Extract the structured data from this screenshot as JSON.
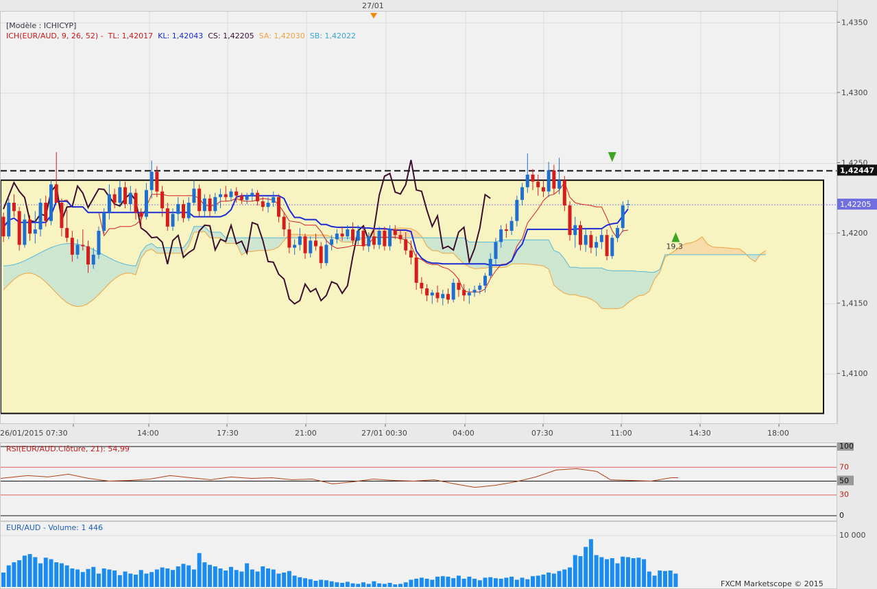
{
  "top_marker": {
    "label": "27/01"
  },
  "legend": {
    "model": "[Modèle : ICHICYP]",
    "ich": "ICH(EUR/AUD, 9, 26, 52) -",
    "tl": "TL: 1,42017",
    "kl": "KL: 1,42043",
    "cs": "CS: 1,42205",
    "sa": "SA: 1,42030",
    "sb": "SB: 1,42022"
  },
  "price_axis": {
    "ticks": [
      "1,4350",
      "1,4300",
      "1,4250",
      "1,4200",
      "1,4150",
      "1,4100"
    ],
    "tick_values": [
      1.435,
      1.43,
      1.425,
      1.42,
      1.415,
      1.41
    ],
    "box_black": "1,42447",
    "box_blue": "1,42205"
  },
  "time_axis": {
    "labels": [
      "26/01/2015 07:30",
      "14:00",
      "17:30",
      "21:00",
      "27/01 00:30",
      "04:00",
      "07:30",
      "11:00",
      "14:30",
      "18:00"
    ]
  },
  "annotations": {
    "pips": "19,3"
  },
  "rsi": {
    "title": "RSI(EUR/AUD.Clôture, 21): 54,99",
    "levels": [
      "100",
      "70",
      "50",
      "30",
      "0"
    ]
  },
  "volume": {
    "title": "EUR/AUD - Volume: 1 446",
    "axis_label": "10 000",
    "copyright": "FXCM Marketscope © 2015"
  },
  "colors": {
    "bull": "#1f6fd1",
    "bear": "#d51d1d",
    "tenkan": "#d62020",
    "kijun": "#1a2bd6",
    "chikou": "#3b0d2e",
    "senkou_a": "#f0a340",
    "senkou_b": "#58b8d6",
    "zone_fill": "#f8f4c2",
    "volume": "#1a8cf0"
  },
  "chart_data": {
    "type": "candlestick",
    "symbol": "EUR/AUD",
    "ylim": [
      1.4065,
      1.4358
    ],
    "resistance": 1.42447,
    "current_price": 1.42205,
    "zone": [
      1.4072,
      1.4238
    ],
    "candles": [
      [
        1.4212,
        1.4215,
        1.4194,
        1.4198
      ],
      [
        1.4198,
        1.4225,
        1.4196,
        1.4222
      ],
      [
        1.4222,
        1.4228,
        1.4212,
        1.4216
      ],
      [
        1.4216,
        1.4219,
        1.4188,
        1.4192
      ],
      [
        1.4192,
        1.4214,
        1.419,
        1.421
      ],
      [
        1.421,
        1.4213,
        1.4195,
        1.42
      ],
      [
        1.42,
        1.4216,
        1.4193,
        1.4203
      ],
      [
        1.4203,
        1.4225,
        1.4198,
        1.4222
      ],
      [
        1.4222,
        1.4227,
        1.4205,
        1.4209
      ],
      [
        1.4209,
        1.4238,
        1.4206,
        1.4235
      ],
      [
        1.4235,
        1.4258,
        1.4228,
        1.4222
      ],
      [
        1.4222,
        1.4225,
        1.4198,
        1.4204
      ],
      [
        1.4204,
        1.4217,
        1.4194,
        1.4197
      ],
      [
        1.4197,
        1.4202,
        1.418,
        1.4185
      ],
      [
        1.4185,
        1.4196,
        1.4182,
        1.4192
      ],
      [
        1.4192,
        1.4203,
        1.4188,
        1.4191
      ],
      [
        1.4191,
        1.4195,
        1.4172,
        1.4178
      ],
      [
        1.4178,
        1.419,
        1.4175,
        1.4185
      ],
      [
        1.4185,
        1.4205,
        1.4182,
        1.4202
      ],
      [
        1.4202,
        1.4218,
        1.42,
        1.4215
      ],
      [
        1.4215,
        1.4235,
        1.421,
        1.4228
      ],
      [
        1.4228,
        1.4232,
        1.4218,
        1.4222
      ],
      [
        1.4222,
        1.4238,
        1.422,
        1.4233
      ],
      [
        1.4233,
        1.4237,
        1.4218,
        1.4221
      ],
      [
        1.4221,
        1.4234,
        1.4216,
        1.4229
      ],
      [
        1.4229,
        1.4232,
        1.421,
        1.4215
      ],
      [
        1.4215,
        1.4218,
        1.4204,
        1.4212
      ],
      [
        1.4212,
        1.4236,
        1.421,
        1.4231
      ],
      [
        1.4231,
        1.4252,
        1.4225,
        1.4244
      ],
      [
        1.4244,
        1.4248,
        1.4226,
        1.423
      ],
      [
        1.423,
        1.4234,
        1.4212,
        1.4218
      ],
      [
        1.4218,
        1.4222,
        1.4202,
        1.4205
      ],
      [
        1.4205,
        1.4218,
        1.4202,
        1.4214
      ],
      [
        1.4214,
        1.4226,
        1.4209,
        1.4221
      ],
      [
        1.4221,
        1.4224,
        1.4208,
        1.4211
      ],
      [
        1.4211,
        1.4226,
        1.4209,
        1.4222
      ],
      [
        1.4222,
        1.4238,
        1.422,
        1.4232
      ],
      [
        1.4232,
        1.4235,
        1.4212,
        1.4216
      ],
      [
        1.4216,
        1.4228,
        1.4212,
        1.4225
      ],
      [
        1.4225,
        1.4228,
        1.4212,
        1.4216
      ],
      [
        1.4216,
        1.4229,
        1.4214,
        1.4226
      ],
      [
        1.4226,
        1.4232,
        1.4218,
        1.4228
      ],
      [
        1.4228,
        1.4234,
        1.4223,
        1.4226
      ],
      [
        1.4226,
        1.4232,
        1.4223,
        1.423
      ],
      [
        1.423,
        1.4233,
        1.4222,
        1.4227
      ],
      [
        1.4227,
        1.4229,
        1.4221,
        1.4224
      ],
      [
        1.4224,
        1.4229,
        1.4221,
        1.4227
      ],
      [
        1.4227,
        1.4232,
        1.4223,
        1.4229
      ],
      [
        1.4229,
        1.4231,
        1.422,
        1.4223
      ],
      [
        1.4223,
        1.4226,
        1.4216,
        1.4219
      ],
      [
        1.4219,
        1.4226,
        1.4215,
        1.4222
      ],
      [
        1.4222,
        1.423,
        1.4219,
        1.4226
      ],
      [
        1.4226,
        1.4228,
        1.4208,
        1.4212
      ],
      [
        1.4212,
        1.4215,
        1.4198,
        1.4203
      ],
      [
        1.4203,
        1.4208,
        1.4186,
        1.419
      ],
      [
        1.419,
        1.4196,
        1.4185,
        1.4192
      ],
      [
        1.4192,
        1.4204,
        1.4188,
        1.4198
      ],
      [
        1.4198,
        1.42,
        1.4182,
        1.4186
      ],
      [
        1.4186,
        1.4198,
        1.4183,
        1.4195
      ],
      [
        1.4195,
        1.42,
        1.4188,
        1.4191
      ],
      [
        1.4191,
        1.4194,
        1.4175,
        1.4179
      ],
      [
        1.4179,
        1.4196,
        1.4177,
        1.4192
      ],
      [
        1.4192,
        1.4199,
        1.4188,
        1.4196
      ],
      [
        1.4196,
        1.4203,
        1.4193,
        1.42
      ],
      [
        1.42,
        1.4205,
        1.4195,
        1.4198
      ],
      [
        1.4198,
        1.4206,
        1.4196,
        1.4203
      ],
      [
        1.4203,
        1.4208,
        1.4192,
        1.4195
      ],
      [
        1.4195,
        1.4206,
        1.4192,
        1.4202
      ],
      [
        1.4202,
        1.4205,
        1.4188,
        1.4191
      ],
      [
        1.4191,
        1.4201,
        1.4187,
        1.4198
      ],
      [
        1.4198,
        1.4204,
        1.4189,
        1.4192
      ],
      [
        1.4192,
        1.4205,
        1.4189,
        1.4202
      ],
      [
        1.4202,
        1.4205,
        1.4188,
        1.4191
      ],
      [
        1.4191,
        1.4206,
        1.4188,
        1.4203
      ],
      [
        1.4203,
        1.4206,
        1.4196,
        1.4199
      ],
      [
        1.4199,
        1.4203,
        1.4193,
        1.4196
      ],
      [
        1.4196,
        1.4201,
        1.4185,
        1.4188
      ],
      [
        1.4188,
        1.4195,
        1.4178,
        1.4183
      ],
      [
        1.4183,
        1.4186,
        1.416,
        1.4165
      ],
      [
        1.4165,
        1.4169,
        1.4157,
        1.4161
      ],
      [
        1.4161,
        1.4164,
        1.4152,
        1.4156
      ],
      [
        1.4156,
        1.416,
        1.415,
        1.4158
      ],
      [
        1.4158,
        1.4163,
        1.4151,
        1.4154
      ],
      [
        1.4154,
        1.416,
        1.4149,
        1.4157
      ],
      [
        1.4157,
        1.4161,
        1.415,
        1.4153
      ],
      [
        1.4153,
        1.4168,
        1.4151,
        1.4165
      ],
      [
        1.4165,
        1.4168,
        1.4155,
        1.416
      ],
      [
        1.416,
        1.4164,
        1.4152,
        1.4156
      ],
      [
        1.4156,
        1.4161,
        1.415,
        1.4158
      ],
      [
        1.4158,
        1.4163,
        1.4155,
        1.416
      ],
      [
        1.416,
        1.4165,
        1.4157,
        1.4163
      ],
      [
        1.4163,
        1.4172,
        1.4158,
        1.417
      ],
      [
        1.417,
        1.4186,
        1.4168,
        1.4182
      ],
      [
        1.4182,
        1.4197,
        1.4178,
        1.4194
      ],
      [
        1.4194,
        1.4206,
        1.419,
        1.4203
      ],
      [
        1.4203,
        1.4207,
        1.4197,
        1.4202
      ],
      [
        1.4202,
        1.4212,
        1.4199,
        1.4209
      ],
      [
        1.4209,
        1.4227,
        1.4205,
        1.4224
      ],
      [
        1.4224,
        1.4236,
        1.422,
        1.4233
      ],
      [
        1.4233,
        1.4257,
        1.4229,
        1.4242
      ],
      [
        1.4242,
        1.4246,
        1.4231,
        1.4237
      ],
      [
        1.4237,
        1.4242,
        1.4227,
        1.4233
      ],
      [
        1.4233,
        1.4238,
        1.4226,
        1.423
      ],
      [
        1.423,
        1.4251,
        1.4226,
        1.4245
      ],
      [
        1.4245,
        1.4249,
        1.4228,
        1.4232
      ],
      [
        1.4232,
        1.4254,
        1.4228,
        1.4238
      ],
      [
        1.4238,
        1.4241,
        1.4216,
        1.422
      ],
      [
        1.422,
        1.4223,
        1.4195,
        1.4199
      ],
      [
        1.4199,
        1.4212,
        1.419,
        1.4206
      ],
      [
        1.4206,
        1.4209,
        1.4188,
        1.4192
      ],
      [
        1.4192,
        1.4203,
        1.4187,
        1.4199
      ],
      [
        1.4199,
        1.4202,
        1.4186,
        1.419
      ],
      [
        1.419,
        1.4198,
        1.4184,
        1.4194
      ],
      [
        1.4194,
        1.4203,
        1.4189,
        1.4199
      ],
      [
        1.4199,
        1.4203,
        1.4181,
        1.4184
      ],
      [
        1.4184,
        1.4199,
        1.4182,
        1.4197
      ],
      [
        1.4197,
        1.4206,
        1.4194,
        1.4204
      ],
      [
        1.4204,
        1.4223,
        1.4201,
        1.422
      ],
      [
        1.4221,
        1.4224,
        1.4218,
        1.4221
      ]
    ],
    "x_rsi": [
      0,
      0.02,
      0.04,
      0.07,
      0.1,
      0.13,
      0.16,
      0.19,
      0.22,
      0.25,
      0.28,
      0.31,
      0.34,
      0.37,
      0.4,
      0.43,
      0.46,
      0.49,
      0.52,
      0.55,
      0.58,
      0.61,
      0.64,
      0.67,
      0.7,
      0.73,
      0.76,
      0.79,
      0.82,
      0.85,
      0.88,
      0.9,
      0.93,
      0.96,
      0.99,
      1.0
    ],
    "rsi_values": [
      54,
      56,
      58,
      56,
      60,
      54,
      50,
      51,
      53,
      58,
      55,
      52,
      56,
      54,
      55,
      52,
      53,
      46,
      49,
      53,
      51,
      50,
      52,
      46,
      41,
      44,
      49,
      56,
      66,
      68,
      64,
      52,
      51,
      50,
      55,
      55
    ],
    "volume_max": 10000,
    "volume_values": [
      2800,
      4200,
      4800,
      5200,
      6100,
      6400,
      5800,
      4600,
      5700,
      5400,
      4800,
      4600,
      4200,
      3600,
      3400,
      2900,
      3500,
      3900,
      2600,
      3600,
      3400,
      3200,
      2300,
      3000,
      2600,
      2400,
      3300,
      2600,
      2900,
      3400,
      3800,
      3600,
      3300,
      4000,
      4500,
      4200,
      3400,
      6600,
      4800,
      4300,
      4000,
      3600,
      3200,
      3900,
      3300,
      3000,
      4600,
      3400,
      3000,
      4000,
      3600,
      3400,
      2600,
      2800,
      3100,
      2200,
      1900,
      1700,
      1500,
      1200,
      1400,
      1300,
      1100,
      900,
      800,
      1000,
      700,
      600,
      900,
      600,
      1100,
      700,
      600,
      800,
      500,
      600,
      900,
      1400,
      1600,
      1800,
      1600,
      1400,
      2000,
      2100,
      2000,
      1700,
      2200,
      1600,
      2000,
      1600,
      1300,
      1800,
      1900,
      1700,
      1600,
      1800,
      2000,
      1400,
      1800,
      1500,
      2100,
      2200,
      2400,
      2800,
      2600,
      3100,
      3400,
      3800,
      6200,
      6000,
      7800,
      9300,
      6200,
      5800,
      5400,
      5600,
      4600,
      5900,
      5800,
      5600,
      5700,
      5400,
      3000,
      2200,
      3200,
      3100,
      3200,
      2600
    ]
  }
}
